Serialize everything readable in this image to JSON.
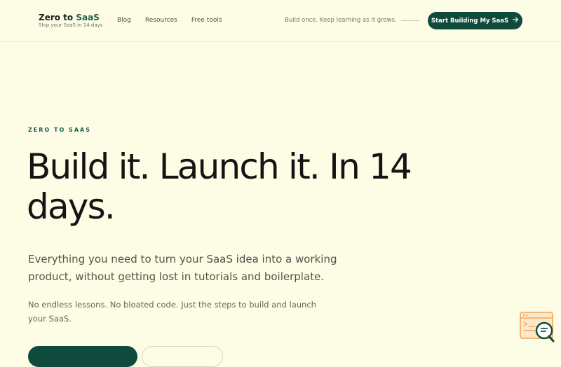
{
  "brand": {
    "name_prefix": "Zero to ",
    "name_accent": "SaaS",
    "tagline": "Ship your SaaS in 14 days"
  },
  "nav": {
    "items": [
      {
        "label": "Blog"
      },
      {
        "label": "Resources"
      },
      {
        "label": "Free tools"
      }
    ]
  },
  "header": {
    "tagline": "Build once. Keep learning as it grows.",
    "cta_label": "Start Building My SaaS",
    "cta_icon": "arrow-right-icon"
  },
  "hero": {
    "eyebrow": "ZERO TO SAAS",
    "headline": "Build it. Launch it. In 14 days.",
    "subheadline": "Everything you need to turn your SaaS idea into a working product, without getting lost in tutorials and boilerplate.",
    "small_print": "No endless lessons. No bloated code. Just the steps to build and launch your SaaS."
  },
  "colors": {
    "background": "#fdfde6",
    "accent": "#0f4a3c",
    "widget": "#f2a65a"
  },
  "widget": {
    "icon": "search-chat-icon"
  }
}
